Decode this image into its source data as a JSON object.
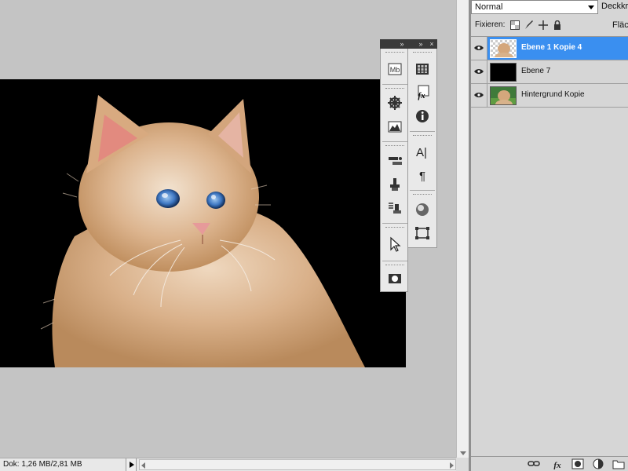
{
  "status": {
    "doc_info": "Dok: 1,26 MB/2,81 MB"
  },
  "layers_panel": {
    "blend_mode": "Normal",
    "opacity_label": "Deckkraft",
    "lock_label": "Fixieren:",
    "fill_label": "Fläche",
    "layers": [
      {
        "name": "Ebene 1 Kopie 4",
        "selected": true,
        "visible": true,
        "thumb": "kitten-transparent"
      },
      {
        "name": "Ebene 7",
        "selected": false,
        "visible": true,
        "thumb": "black"
      },
      {
        "name": "Hintergrund Kopie",
        "selected": false,
        "visible": true,
        "thumb": "kitten-green"
      }
    ]
  },
  "toolbar_panel": {
    "header_buttons": [
      "»",
      "»",
      "×"
    ],
    "left_tools": [
      "minibridge-icon",
      "navigator-icon",
      "histogram-icon",
      "brush-presets-icon",
      "clone-source-icon",
      "tool-presets-icon",
      "cursor-icon",
      "mask-icon"
    ],
    "right_tools": [
      "swatches-icon",
      "styles-icon",
      "info-icon",
      "character-icon",
      "paragraph-icon",
      "3d-icon",
      "transform-icon"
    ],
    "minibridge_text": "Mb",
    "styles_text": "fx",
    "character_text": "A|",
    "paragraph_text": "¶"
  },
  "layers_footer_icons": [
    "link-icon",
    "fx-icon",
    "mask-icon",
    "adjustment-icon",
    "new-group-icon"
  ],
  "colors": {
    "selection": "#3a8ff0",
    "canvas_bg": "#c4c4c4",
    "panel_bg": "#d6d6d6"
  }
}
